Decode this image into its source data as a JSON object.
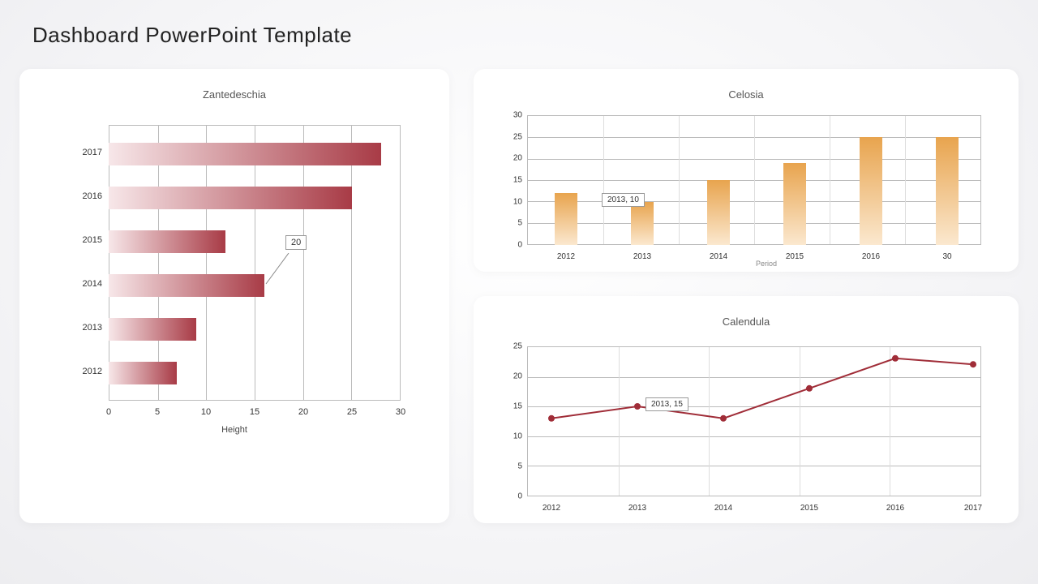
{
  "header": {
    "title": "Dashboard PowerPoint Template"
  },
  "chart_data": [
    {
      "id": "zantedeschia",
      "type": "bar",
      "orientation": "horizontal",
      "title": "Zantedeschia",
      "categories": [
        "2012",
        "2013",
        "2014",
        "2015",
        "2016",
        "2017"
      ],
      "values": [
        7,
        9,
        16,
        12,
        25,
        28
      ],
      "xlabel": "Height",
      "xlim": [
        0,
        30
      ],
      "xticks": [
        0,
        5,
        10,
        15,
        20,
        25,
        30
      ],
      "callout": {
        "label": "20",
        "attached_to": "2014"
      }
    },
    {
      "id": "celosia",
      "type": "bar",
      "orientation": "vertical",
      "title": "Celosia",
      "categories": [
        "2012",
        "2013",
        "2014",
        "2015",
        "2016",
        "30"
      ],
      "values": [
        12,
        10,
        15,
        19,
        25,
        25
      ],
      "xlabel": "Period",
      "ylim": [
        0,
        30
      ],
      "yticks": [
        0,
        5,
        10,
        15,
        20,
        25,
        30
      ],
      "callout": {
        "label": "2013, 10",
        "attached_to": "2013"
      }
    },
    {
      "id": "calendula",
      "type": "line",
      "title": "Calendula",
      "categories": [
        "2012",
        "2013",
        "2014",
        "2015",
        "2016",
        "2017"
      ],
      "values": [
        13,
        15,
        13,
        18,
        23,
        22
      ],
      "ylim": [
        0,
        25
      ],
      "yticks": [
        0,
        5,
        10,
        15,
        20,
        25
      ],
      "callout": {
        "label": "2013, 15",
        "attached_to": "2013"
      }
    }
  ],
  "labels": {
    "z_title": "Zantedeschia",
    "z_axis": "Height",
    "z_callout": "20",
    "z_y": [
      "2017",
      "2016",
      "2015",
      "2014",
      "2013",
      "2012"
    ],
    "z_x": [
      "0",
      "5",
      "10",
      "15",
      "20",
      "25",
      "30"
    ],
    "c_title": "Celosia",
    "c_axis": "Period",
    "c_callout": "2013, 10",
    "c_y": [
      "30",
      "25",
      "20",
      "15",
      "10",
      "5",
      "0"
    ],
    "c_x": [
      "2012",
      "2013",
      "2014",
      "2015",
      "2016",
      "30"
    ],
    "l_title": "Calendula",
    "l_callout": "2013, 15",
    "l_y": [
      "25",
      "20",
      "15",
      "10",
      "5",
      "0"
    ],
    "l_x": [
      "2012",
      "2013",
      "2014",
      "2015",
      "2016",
      "2017"
    ]
  }
}
